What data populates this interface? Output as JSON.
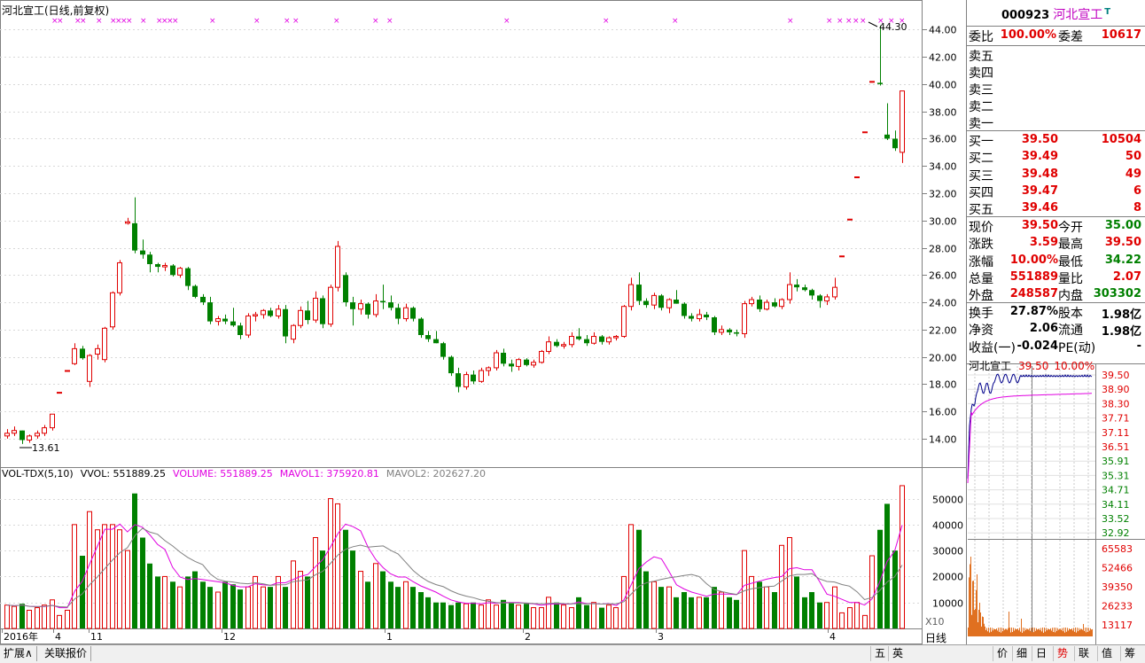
{
  "header": {
    "title": "河北宣工(日线,前复权)"
  },
  "price_axis": [
    "44.00",
    "42.00",
    "40.00",
    "38.00",
    "36.00",
    "34.00",
    "32.00",
    "30.00",
    "28.00",
    "26.00",
    "24.00",
    "22.00",
    "20.00",
    "18.00",
    "16.00",
    "14.00"
  ],
  "vol_axis": [
    "50000",
    "40000",
    "30000",
    "20000",
    "10000"
  ],
  "annotations": {
    "high": "44.30",
    "low": "13.61"
  },
  "x_labels": [
    "2016年",
    "4",
    "11",
    "12",
    "1",
    "2",
    "3",
    "4"
  ],
  "vol_legend": {
    "name": "VOL-TDX(5,10)",
    "vvol": "VVOL: 551889.25",
    "volume": "VOLUME: 551889.25",
    "mavol1": "MAVOL1: 375920.81",
    "mavol2": "MAVOL2: 202627.20"
  },
  "colors": {
    "up": "#e00000",
    "down": "#008000",
    "ma1": "#e000e0",
    "ma2": "#808080",
    "mark": "#e000e0"
  },
  "stock": {
    "code": "000923",
    "name": "河北宣工",
    "t_mark": "T"
  },
  "weibi": {
    "label1": "委比",
    "val1": "100.00%",
    "label2": "委差",
    "val2": "10617"
  },
  "sell": [
    {
      "label": "卖五",
      "price": "",
      "vol": ""
    },
    {
      "label": "卖四",
      "price": "",
      "vol": ""
    },
    {
      "label": "卖三",
      "price": "",
      "vol": ""
    },
    {
      "label": "卖二",
      "price": "",
      "vol": ""
    },
    {
      "label": "卖一",
      "price": "",
      "vol": ""
    }
  ],
  "buy": [
    {
      "label": "买一",
      "price": "39.50",
      "vol": "10504"
    },
    {
      "label": "买二",
      "price": "39.49",
      "vol": "50"
    },
    {
      "label": "买三",
      "price": "39.48",
      "vol": "49"
    },
    {
      "label": "买四",
      "price": "39.47",
      "vol": "6"
    },
    {
      "label": "买五",
      "price": "39.46",
      "vol": "8"
    }
  ],
  "quote": [
    {
      "l1": "现价",
      "v1": "39.50",
      "c1": "red",
      "l2": "今开",
      "v2": "35.00",
      "c2": "green"
    },
    {
      "l1": "涨跌",
      "v1": "3.59",
      "c1": "red",
      "l2": "最高",
      "v2": "39.50",
      "c2": "red"
    },
    {
      "l1": "涨幅",
      "v1": "10.00%",
      "c1": "red",
      "l2": "最低",
      "v2": "34.22",
      "c2": "green"
    },
    {
      "l1": "总量",
      "v1": "551889",
      "c1": "red",
      "l2": "量比",
      "v2": "2.07",
      "c2": "red"
    },
    {
      "l1": "外盘",
      "v1": "248587",
      "c1": "red",
      "l2": "内盘",
      "v2": "303302",
      "c2": "green"
    }
  ],
  "fund": [
    {
      "l1": "换手",
      "v1": "27.87%",
      "l2": "股本",
      "v2": "1.98亿"
    },
    {
      "l1": "净资",
      "v1": "2.06",
      "l2": "流通",
      "v2": "1.98亿"
    },
    {
      "l1": "收益(一)",
      "v1": "-0.024",
      "l2": "PE(动)",
      "v2": "-"
    }
  ],
  "mini": {
    "name": "河北宣工",
    "price": "39.50",
    "pct": "10.00%",
    "right_axis": [
      "39.50",
      "38.90",
      "38.30",
      "37.71",
      "37.11",
      "36.51",
      "35.91",
      "35.31",
      "34.71",
      "34.11",
      "33.52",
      "32.92"
    ],
    "vol_axis": [
      "65583",
      "52466",
      "39350",
      "26233",
      "13117"
    ]
  },
  "x10": "X10",
  "period": "日线",
  "bottom_tabs": [
    "扩展∧",
    "关联报价"
  ],
  "toolbar": [
    "五",
    "英",
    "价",
    "细",
    "日",
    "势",
    "联",
    "值",
    "筹"
  ],
  "chart_data": {
    "type": "candlestick",
    "ylim": [
      12.5,
      45.0
    ],
    "vol_ylim": [
      0,
      56000
    ],
    "candles": [
      [
        14.2,
        14.7,
        14.0,
        14.4,
        9000
      ],
      [
        14.4,
        14.9,
        14.2,
        14.6,
        8500
      ],
      [
        14.6,
        14.6,
        13.61,
        13.9,
        9500
      ],
      [
        13.9,
        14.3,
        13.7,
        14.2,
        7000
      ],
      [
        14.2,
        14.6,
        14.0,
        14.4,
        8000
      ],
      [
        14.4,
        15.0,
        14.2,
        14.8,
        9000
      ],
      [
        14.8,
        15.8,
        14.6,
        15.8,
        11000
      ],
      [
        17.4,
        17.4,
        17.4,
        17.4,
        5000
      ],
      [
        19.0,
        19.0,
        19.0,
        19.0,
        7000
      ],
      [
        19.5,
        21.0,
        19.4,
        20.6,
        40000
      ],
      [
        20.6,
        20.8,
        19.8,
        19.9,
        28000
      ],
      [
        18.2,
        20.2,
        17.8,
        20.1,
        45000
      ],
      [
        20.2,
        20.9,
        19.8,
        20.6,
        38000
      ],
      [
        19.8,
        22.2,
        19.6,
        22.1,
        40000
      ],
      [
        22.2,
        24.8,
        22.0,
        24.7,
        40000
      ],
      [
        24.7,
        27.1,
        24.5,
        26.9,
        38000
      ],
      [
        29.8,
        30.2,
        29.7,
        29.9,
        30000
      ],
      [
        29.8,
        31.7,
        27.6,
        27.8,
        52000
      ],
      [
        27.8,
        28.6,
        27.2,
        27.5,
        35000
      ],
      [
        27.5,
        27.7,
        26.2,
        26.8,
        25000
      ],
      [
        26.8,
        26.9,
        26.2,
        26.6,
        20000
      ],
      [
        26.6,
        26.9,
        26.3,
        26.7,
        20000
      ],
      [
        26.7,
        26.8,
        25.9,
        26.0,
        18000
      ],
      [
        26.0,
        26.6,
        25.8,
        26.5,
        16000
      ],
      [
        26.5,
        26.6,
        24.9,
        25.2,
        20000
      ],
      [
        25.2,
        25.3,
        24.3,
        24.4,
        22000
      ],
      [
        24.4,
        24.6,
        23.8,
        24.0,
        18000
      ],
      [
        24.0,
        24.4,
        22.4,
        22.6,
        16000
      ],
      [
        22.6,
        23.0,
        22.3,
        22.8,
        14000
      ],
      [
        22.8,
        23.1,
        22.4,
        22.6,
        18000
      ],
      [
        22.6,
        23.6,
        22.2,
        22.3,
        17000
      ],
      [
        22.3,
        22.5,
        21.3,
        21.6,
        15000
      ],
      [
        21.6,
        23.2,
        21.4,
        23.0,
        16000
      ],
      [
        23.0,
        23.3,
        22.6,
        23.1,
        20000
      ],
      [
        23.1,
        23.5,
        22.8,
        23.4,
        16000
      ],
      [
        23.4,
        23.6,
        22.9,
        23.0,
        16000
      ],
      [
        23.0,
        23.8,
        22.8,
        23.5,
        20000
      ],
      [
        23.5,
        23.8,
        21.0,
        21.5,
        16000
      ],
      [
        21.3,
        22.4,
        21.0,
        22.3,
        26000
      ],
      [
        22.3,
        23.7,
        22.1,
        23.4,
        22000
      ],
      [
        23.4,
        24.1,
        22.4,
        22.7,
        20000
      ],
      [
        22.7,
        24.8,
        22.5,
        24.3,
        35000
      ],
      [
        24.3,
        24.5,
        22.1,
        22.4,
        30000
      ],
      [
        22.4,
        25.3,
        22.2,
        25.1,
        50000
      ],
      [
        25.1,
        28.5,
        24.8,
        28.1,
        48000
      ],
      [
        26.0,
        26.2,
        23.7,
        24.0,
        38000
      ],
      [
        24.0,
        24.4,
        22.3,
        23.5,
        30000
      ],
      [
        23.5,
        24.2,
        23.1,
        23.9,
        22000
      ],
      [
        23.9,
        24.0,
        22.8,
        23.1,
        18000
      ],
      [
        23.1,
        24.6,
        22.9,
        24.1,
        25000
      ],
      [
        24.1,
        25.3,
        23.5,
        24.0,
        22000
      ],
      [
        24.0,
        24.5,
        23.4,
        23.6,
        18000
      ],
      [
        23.6,
        23.9,
        22.4,
        22.8,
        16000
      ],
      [
        22.8,
        23.9,
        22.6,
        23.6,
        18000
      ],
      [
        23.6,
        23.7,
        22.6,
        22.8,
        16000
      ],
      [
        22.8,
        22.9,
        21.4,
        21.6,
        14000
      ],
      [
        21.6,
        21.9,
        21.1,
        21.3,
        12000
      ],
      [
        21.3,
        21.9,
        21.0,
        21.0,
        10000
      ],
      [
        21.0,
        21.1,
        19.8,
        20.0,
        10000
      ],
      [
        20.0,
        20.1,
        18.6,
        18.8,
        9000
      ],
      [
        18.8,
        19.2,
        17.4,
        17.8,
        10000
      ],
      [
        17.8,
        18.9,
        17.6,
        18.7,
        9500
      ],
      [
        18.7,
        19.0,
        18.0,
        18.2,
        10000
      ],
      [
        18.2,
        19.2,
        18.1,
        19.0,
        9000
      ],
      [
        19.0,
        19.3,
        18.6,
        19.2,
        11000
      ],
      [
        19.2,
        20.5,
        19.0,
        20.3,
        9000
      ],
      [
        20.3,
        20.6,
        19.3,
        19.5,
        11000
      ],
      [
        19.5,
        19.8,
        18.9,
        19.3,
        10000
      ],
      [
        19.3,
        19.9,
        19.0,
        19.8,
        9000
      ],
      [
        19.8,
        19.9,
        19.3,
        19.4,
        9500
      ],
      [
        19.4,
        19.8,
        19.2,
        19.6,
        8000
      ],
      [
        19.6,
        20.5,
        19.5,
        20.4,
        8000
      ],
      [
        20.4,
        21.5,
        20.2,
        21.1,
        12000
      ],
      [
        21.1,
        21.3,
        20.7,
        20.8,
        10000
      ],
      [
        20.8,
        21.1,
        20.6,
        20.9,
        9000
      ],
      [
        20.9,
        21.8,
        20.7,
        21.5,
        8000
      ],
      [
        21.5,
        22.1,
        21.2,
        21.3,
        12000
      ],
      [
        21.3,
        21.6,
        20.8,
        21.0,
        9000
      ],
      [
        21.0,
        21.8,
        20.9,
        21.5,
        10000
      ],
      [
        21.5,
        21.6,
        20.9,
        21.1,
        8000
      ],
      [
        21.1,
        21.5,
        20.9,
        21.4,
        9000
      ],
      [
        21.4,
        21.6,
        21.2,
        21.5,
        8000
      ],
      [
        21.5,
        23.8,
        21.4,
        23.7,
        20000
      ],
      [
        23.7,
        25.8,
        23.4,
        25.3,
        40000
      ],
      [
        25.3,
        26.2,
        23.8,
        24.1,
        38000
      ],
      [
        24.1,
        24.3,
        23.6,
        23.8,
        22000
      ],
      [
        23.8,
        24.7,
        23.5,
        24.5,
        18000
      ],
      [
        24.5,
        24.6,
        23.4,
        23.6,
        16000
      ],
      [
        23.6,
        24.3,
        23.2,
        24.2,
        16000
      ],
      [
        24.2,
        24.9,
        23.9,
        23.9,
        12000
      ],
      [
        23.9,
        24.0,
        22.8,
        23.0,
        14000
      ],
      [
        23.0,
        23.2,
        22.6,
        22.8,
        12000
      ],
      [
        22.8,
        23.5,
        22.6,
        23.1,
        12000
      ],
      [
        23.1,
        23.3,
        22.7,
        22.9,
        12000
      ],
      [
        22.9,
        23.0,
        21.6,
        21.8,
        16000
      ],
      [
        21.8,
        22.3,
        21.6,
        22.0,
        14000
      ],
      [
        22.0,
        22.1,
        21.6,
        21.8,
        12000
      ],
      [
        21.8,
        22.0,
        21.5,
        21.7,
        11000
      ],
      [
        21.7,
        24.1,
        21.4,
        23.9,
        30000
      ],
      [
        23.9,
        24.4,
        23.7,
        24.2,
        20000
      ],
      [
        24.2,
        24.5,
        23.3,
        23.5,
        18000
      ],
      [
        23.5,
        24.2,
        23.4,
        24.0,
        16000
      ],
      [
        24.0,
        24.3,
        23.6,
        23.7,
        14000
      ],
      [
        23.7,
        24.3,
        23.5,
        24.2,
        32000
      ],
      [
        24.2,
        26.2,
        23.9,
        25.3,
        35000
      ],
      [
        25.3,
        25.7,
        24.8,
        25.1,
        20000
      ],
      [
        25.1,
        25.3,
        24.8,
        24.9,
        12000
      ],
      [
        24.9,
        25.0,
        24.2,
        24.5,
        14000
      ],
      [
        24.5,
        24.6,
        23.6,
        24.1,
        10000
      ],
      [
        24.1,
        24.6,
        23.8,
        24.4,
        10000
      ],
      [
        24.4,
        25.8,
        24.2,
        25.1,
        16000
      ],
      [
        27.4,
        27.4,
        27.4,
        27.4,
        6000
      ],
      [
        30.1,
        30.1,
        30.1,
        30.1,
        8000
      ],
      [
        33.2,
        33.2,
        33.2,
        33.2,
        10000
      ],
      [
        36.5,
        36.5,
        36.5,
        36.5,
        5000
      ],
      [
        40.2,
        40.2,
        40.2,
        40.2,
        28000
      ],
      [
        40.1,
        44.3,
        39.9,
        40.0,
        38000
      ],
      [
        36.3,
        38.6,
        35.9,
        36.0,
        48000
      ],
      [
        36.0,
        36.6,
        35.1,
        35.3,
        30000
      ],
      [
        35.0,
        39.5,
        34.22,
        39.5,
        55000
      ]
    ]
  }
}
